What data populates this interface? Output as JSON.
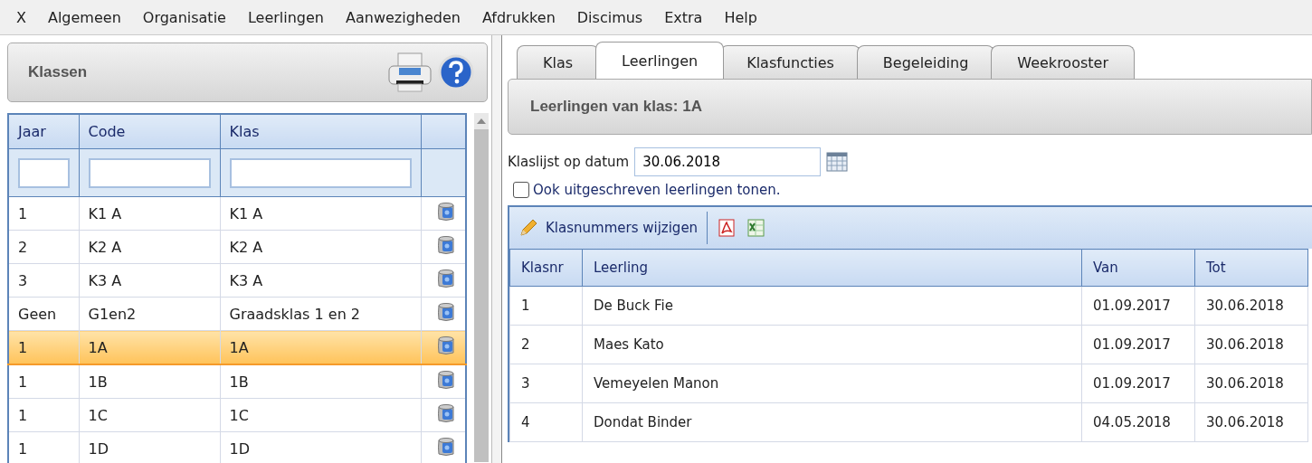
{
  "menu": [
    {
      "label": "X"
    },
    {
      "label": "Algemeen"
    },
    {
      "label": "Organisatie"
    },
    {
      "label": "Leerlingen"
    },
    {
      "label": "Aanwezigheden"
    },
    {
      "label": "Afdrukken"
    },
    {
      "label": "Discimus"
    },
    {
      "label": "Extra"
    },
    {
      "label": "Help"
    }
  ],
  "classes_panel": {
    "title": "Klassen",
    "columns": [
      "Jaar",
      "Code",
      "Klas"
    ],
    "rows": [
      {
        "jaar": "1",
        "code": "K1 A",
        "klas": "K1 A",
        "selected": false
      },
      {
        "jaar": "2",
        "code": "K2 A",
        "klas": "K2 A",
        "selected": false
      },
      {
        "jaar": "3",
        "code": "K3 A",
        "klas": "K3 A",
        "selected": false
      },
      {
        "jaar": "Geen",
        "code": "G1en2",
        "klas": "Graadsklas 1 en 2",
        "selected": false
      },
      {
        "jaar": "1",
        "code": "1A",
        "klas": "1A",
        "selected": true
      },
      {
        "jaar": "1",
        "code": "1B",
        "klas": "1B",
        "selected": false
      },
      {
        "jaar": "1",
        "code": "1C",
        "klas": "1C",
        "selected": false
      },
      {
        "jaar": "1",
        "code": "1D",
        "klas": "1D",
        "selected": false
      }
    ]
  },
  "tabs": [
    {
      "label": "Klas",
      "selected": false
    },
    {
      "label": "Leerlingen",
      "selected": true
    },
    {
      "label": "Klasfuncties",
      "selected": false
    },
    {
      "label": "Begeleiding",
      "selected": false
    },
    {
      "label": "Weekrooster",
      "selected": false
    }
  ],
  "students_panel": {
    "title": "Leerlingen van klas: 1A",
    "date_label": "Klaslijst op datum",
    "date_value": "30.06.2018",
    "show_unenrolled": {
      "label": "Ook uitgeschreven leerlingen tonen.",
      "checked": false
    },
    "toolbar_button": "Klasnummers wijzigen",
    "columns": [
      "Klasnr",
      "Leerling",
      "Van",
      "Tot"
    ],
    "rows": [
      {
        "nr": "1",
        "name": "De Buck Fie",
        "from": "01.09.2017",
        "to": "30.06.2018"
      },
      {
        "nr": "2",
        "name": "Maes Kato",
        "from": "01.09.2017",
        "to": "30.06.2018"
      },
      {
        "nr": "3",
        "name": "Vemeyelen Manon",
        "from": "01.09.2017",
        "to": "30.06.2018"
      },
      {
        "nr": "4",
        "name": "Dondat Binder",
        "from": "04.05.2018",
        "to": "30.06.2018"
      }
    ]
  }
}
